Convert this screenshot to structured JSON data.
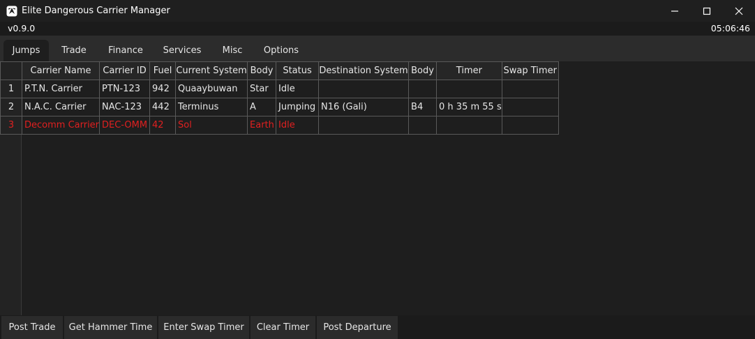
{
  "window": {
    "title": "Elite Dangerous Carrier Manager",
    "version": "v0.9.0",
    "clock": "05:06:46"
  },
  "tabs": [
    {
      "label": "Jumps",
      "active": true
    },
    {
      "label": "Trade",
      "active": false
    },
    {
      "label": "Finance",
      "active": false
    },
    {
      "label": "Services",
      "active": false
    },
    {
      "label": "Misc",
      "active": false
    },
    {
      "label": "Options",
      "active": false
    }
  ],
  "grid": {
    "columns": [
      "Carrier Name",
      "Carrier ID",
      "Fuel",
      "Current System",
      "Body",
      "Status",
      "Destination System",
      "Body",
      "Timer",
      "Swap Timer"
    ],
    "rows": [
      {
        "index": "1",
        "highlight": false,
        "cells": [
          "P.T.N. Carrier",
          "PTN-123",
          "942",
          "Quaaybuwan",
          "Star",
          "Idle",
          "",
          "",
          "",
          ""
        ]
      },
      {
        "index": "2",
        "highlight": false,
        "cells": [
          "N.A.C. Carrier",
          "NAC-123",
          "442",
          "Terminus",
          "A",
          "Jumping",
          "N16 (Gali)",
          "B4",
          "0 h 35 m 55 s",
          ""
        ]
      },
      {
        "index": "3",
        "highlight": true,
        "cells": [
          "Decomm Carrier",
          "DEC-OMM",
          "42",
          "Sol",
          "Earth",
          "Idle",
          "",
          "",
          "",
          ""
        ]
      }
    ],
    "highlight_color": "#e02020"
  },
  "buttons": {
    "post_trade": "Post Trade",
    "get_hammer_time": "Get Hammer Time",
    "enter_swap_timer": "Enter Swap Timer",
    "clear_timer": "Clear Timer",
    "post_departure": "Post Departure"
  },
  "icons": {
    "app": "carrier-app-icon",
    "minimize": "minimize-icon",
    "maximize": "maximize-icon",
    "close": "close-icon"
  }
}
